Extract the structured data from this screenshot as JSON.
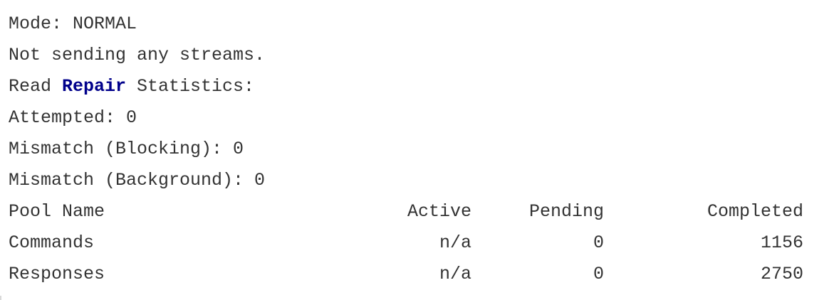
{
  "status": {
    "mode": "Mode: NORMAL",
    "streams": "Not sending any streams.",
    "read_repair_prefix": "Read ",
    "read_repair_keyword": "Repair",
    "read_repair_suffix": " Statistics:",
    "attempted": "Attempted: 0",
    "mismatch_blocking": "Mismatch (Blocking): 0",
    "mismatch_background": "Mismatch (Background): 0"
  },
  "pool_table": {
    "headers": {
      "name": "Pool Name",
      "active": "Active",
      "pending": "Pending",
      "completed": "Completed"
    },
    "rows": [
      {
        "name": "Commands",
        "active": "n/a",
        "pending": "0",
        "completed": "1156"
      },
      {
        "name": "Responses",
        "active": "n/a",
        "pending": "0",
        "completed": "2750"
      }
    ]
  },
  "colors": {
    "text": "#333333",
    "keyword": "#00008b",
    "background": "#ffffff"
  }
}
